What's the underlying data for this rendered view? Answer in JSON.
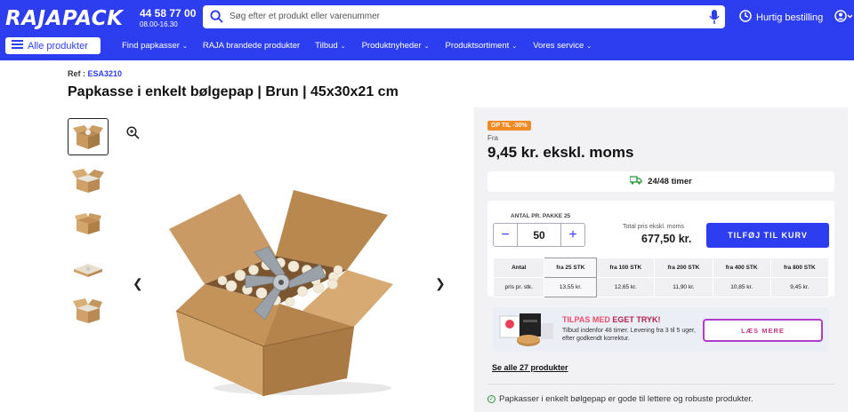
{
  "header": {
    "logo": "RAJAPACK",
    "phone": "44 58 77 00",
    "hours": "08.00-16.30",
    "search_placeholder": "Søg efter et produkt eller varenummer",
    "quick_order": "Hurtig bestilling",
    "all_products": "Alle produkter",
    "nav": [
      "Find papkasser",
      "RAJA brandede produkter",
      "Tilbud",
      "Produktnyheder",
      "Produktsortiment",
      "Vores service"
    ],
    "brand_color": "#2d3ef0"
  },
  "product": {
    "ref_label": "Ref :",
    "ref_code": "ESA3210",
    "title": "Papkasse i enkelt bølgepap | Brun | 45x30x21 cm"
  },
  "pricing": {
    "badge": "OP TIL -30%",
    "from_label": "Fra",
    "price": "9,45 kr.",
    "price_suffix": "ekskl. moms",
    "delivery": "24/48 timer",
    "qty_label": "ANTAL PR. PAKKE 25",
    "qty_value": "50",
    "total_label": "Total pris  ekskl. moms",
    "total_value": "677,50 kr.",
    "add_to_cart": "TILFØJ TIL KURV"
  },
  "tiers": {
    "header": [
      "Antal",
      "fra 25 STK",
      "fra 100 STK",
      "fra 200 STK",
      "fra 400 STK",
      "fra 800 STK"
    ],
    "row": [
      "pris pr. stk.",
      "13,55 kr.",
      "12,65 kr.",
      "11,90 kr.",
      "10,85 kr.",
      "9,45 kr."
    ]
  },
  "promo": {
    "title_prefix": "TILPAS MED ",
    "title_bold": "EGET TRYK!",
    "desc": "Tilbud indenfor 48 timer. Levering fra 3 til 5 uger, efter godkendt korrektur.",
    "button": "LÆS MERE"
  },
  "see_all": "Se alle 27 produkter",
  "features": [
    "Papkasser i enkelt bølgepap er gode til lettere og robuste produkter."
  ]
}
